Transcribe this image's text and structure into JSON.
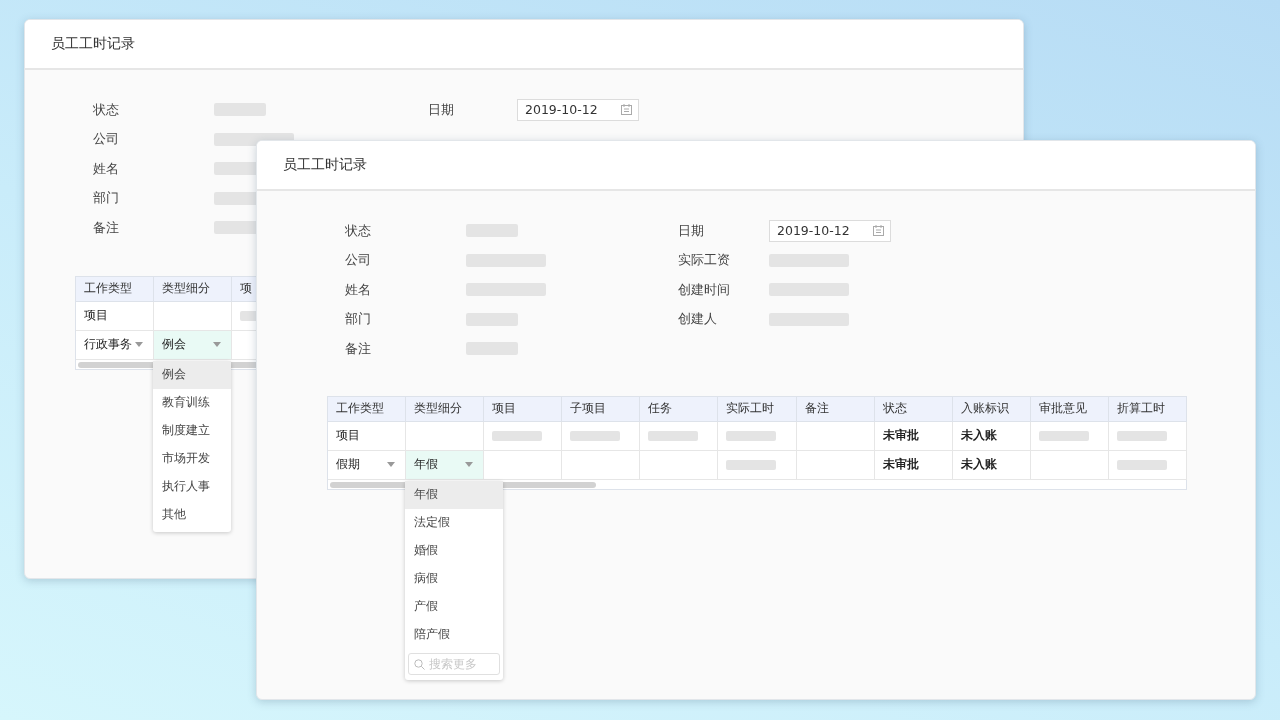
{
  "windows": [
    {
      "title": "员工工时记录",
      "form": {
        "left": [
          {
            "label": "状态",
            "kind": "blank_short"
          },
          {
            "label": "公司",
            "kind": "blank_long"
          },
          {
            "label": "姓名",
            "kind": "blank_long"
          },
          {
            "label": "部门",
            "kind": "blank_short"
          },
          {
            "label": "备注",
            "kind": "blank_short"
          }
        ],
        "right": [
          {
            "label": "日期",
            "kind": "date",
            "value": "2019-10-12"
          }
        ]
      },
      "table": {
        "columns": [
          "工作类型",
          "类型细分",
          "项"
        ],
        "rows": [
          [
            {
              "kind": "text",
              "text": "项目"
            },
            {
              "kind": "empty"
            },
            {
              "kind": "blank"
            }
          ],
          [
            {
              "kind": "select",
              "text": "行政事务",
              "selected": false
            },
            {
              "kind": "select",
              "text": "例会",
              "selected": true,
              "options": [
                {
                  "label": "例会",
                  "selected": true
                },
                {
                  "label": "教育训练",
                  "selected": false
                },
                {
                  "label": "制度建立",
                  "selected": false
                },
                {
                  "label": "市场开发",
                  "selected": false
                },
                {
                  "label": "执行人事",
                  "selected": false
                },
                {
                  "label": "其他",
                  "selected": false
                }
              ]
            },
            {
              "kind": "empty"
            }
          ]
        ]
      }
    },
    {
      "title": "员工工时记录",
      "form": {
        "left": [
          {
            "label": "状态",
            "kind": "blank_short"
          },
          {
            "label": "公司",
            "kind": "blank_long"
          },
          {
            "label": "姓名",
            "kind": "blank_long"
          },
          {
            "label": "部门",
            "kind": "blank_short"
          },
          {
            "label": "备注",
            "kind": "blank_short"
          }
        ],
        "right": [
          {
            "label": "日期",
            "kind": "date",
            "value": "2019-10-12"
          },
          {
            "label": "实际工资",
            "kind": "blank_long"
          },
          {
            "label": "创建时间",
            "kind": "blank_long"
          },
          {
            "label": "创建人",
            "kind": "blank_long"
          }
        ]
      },
      "table": {
        "columns": [
          "工作类型",
          "类型细分",
          "项目",
          "子项目",
          "任务",
          "实际工时",
          "备注",
          "状态",
          "入账标识",
          "审批意见",
          "折算工时"
        ],
        "rows": [
          [
            {
              "kind": "text",
              "text": "项目"
            },
            {
              "kind": "empty"
            },
            {
              "kind": "blank"
            },
            {
              "kind": "blank"
            },
            {
              "kind": "blank"
            },
            {
              "kind": "blank"
            },
            {
              "kind": "empty"
            },
            {
              "kind": "text",
              "text": "未审批"
            },
            {
              "kind": "text",
              "text": "未入账"
            },
            {
              "kind": "blank"
            },
            {
              "kind": "blank"
            }
          ],
          [
            {
              "kind": "select",
              "text": "假期",
              "selected": false
            },
            {
              "kind": "select",
              "text": "年假",
              "selected": true,
              "search_placeholder": "搜索更多",
              "options": [
                {
                  "label": "年假",
                  "selected": true
                },
                {
                  "label": "法定假",
                  "selected": false
                },
                {
                  "label": "婚假",
                  "selected": false
                },
                {
                  "label": "病假",
                  "selected": false
                },
                {
                  "label": "产假",
                  "selected": false
                },
                {
                  "label": "陪产假",
                  "selected": false
                }
              ]
            },
            {
              "kind": "empty"
            },
            {
              "kind": "empty"
            },
            {
              "kind": "empty"
            },
            {
              "kind": "blank"
            },
            {
              "kind": "empty"
            },
            {
              "kind": "text",
              "text": "未审批"
            },
            {
              "kind": "text",
              "text": "未入账"
            },
            {
              "kind": "empty"
            },
            {
              "kind": "blank"
            }
          ]
        ]
      }
    }
  ]
}
